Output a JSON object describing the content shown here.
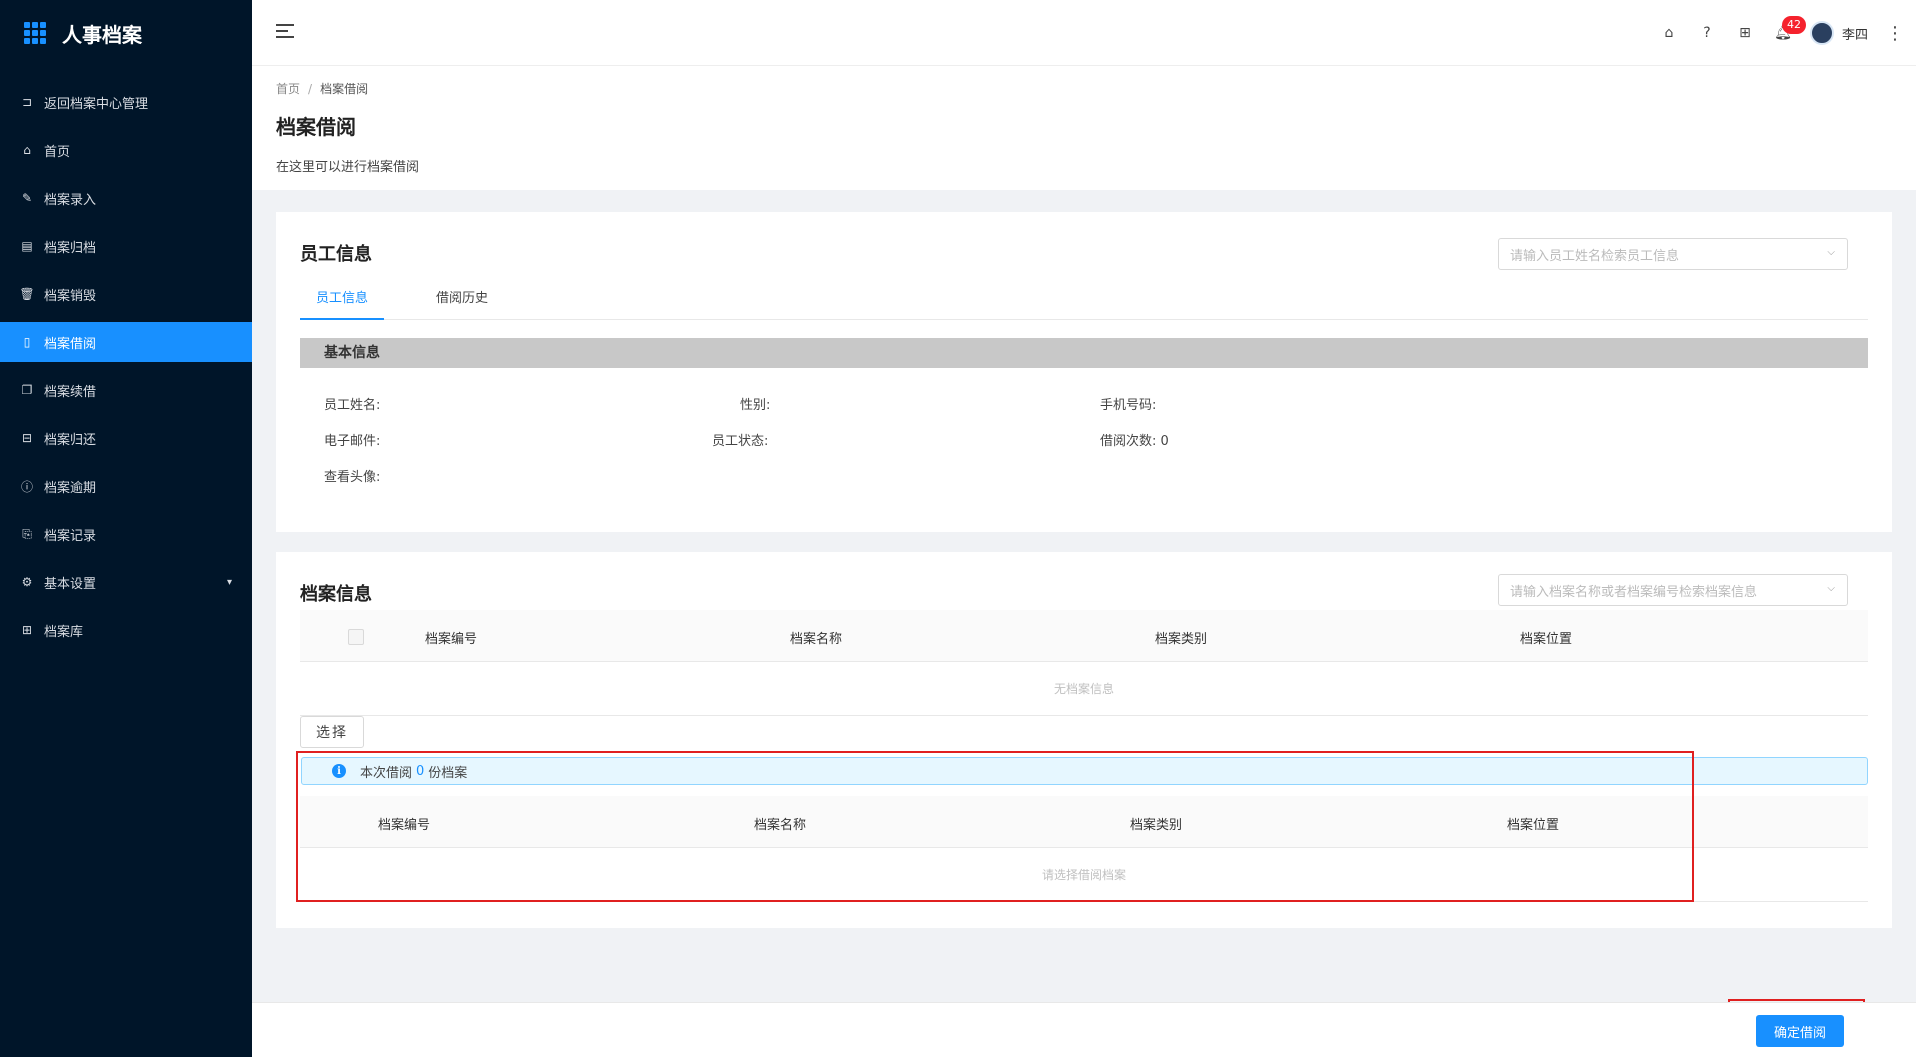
{
  "app": {
    "title": "人事档案"
  },
  "sidebar": {
    "items": [
      {
        "label": "返回档案中心管理",
        "icon": "exit-icon"
      },
      {
        "label": "首页",
        "icon": "home-icon"
      },
      {
        "label": "档案录入",
        "icon": "edit-icon"
      },
      {
        "label": "档案归档",
        "icon": "archive-icon"
      },
      {
        "label": "档案销毁",
        "icon": "trash-icon"
      },
      {
        "label": "档案借阅",
        "icon": "file-icon",
        "active": true
      },
      {
        "label": "档案续借",
        "icon": "copy-icon"
      },
      {
        "label": "档案归还",
        "icon": "return-icon"
      },
      {
        "label": "档案逾期",
        "icon": "warning-icon"
      },
      {
        "label": "档案记录",
        "icon": "record-icon"
      },
      {
        "label": "基本设置",
        "icon": "gear-icon",
        "has_children": true
      },
      {
        "label": "档案库",
        "icon": "grid-icon"
      }
    ]
  },
  "header": {
    "notification_count": "42",
    "user_name": "李四"
  },
  "page": {
    "breadcrumb": [
      "首页",
      "档案借阅"
    ],
    "title": "档案借阅",
    "description": "在这里可以进行档案借阅"
  },
  "employee": {
    "title": "员工信息",
    "search_placeholder": "请输入员工姓名检索员工信息",
    "tabs": [
      "员工信息",
      "借阅历史"
    ],
    "section_title": "基本信息",
    "fields": {
      "name": "员工姓名:",
      "gender": "性别:",
      "phone": "手机号码:",
      "email": "电子邮件:",
      "status": "员工状态:",
      "borrow_count": "借阅次数: 0",
      "avatar": "查看头像:"
    }
  },
  "archive": {
    "title": "档案信息",
    "search_placeholder": "请输入档案名称或者档案编号检索档案信息",
    "columns": [
      "档案编号",
      "档案名称",
      "档案类别",
      "档案位置"
    ],
    "empty_text": "无档案信息",
    "select_button": "选择",
    "alert_prefix": "本次借阅",
    "alert_count": "0",
    "alert_suffix": "份档案",
    "selected_columns": [
      "档案编号",
      "档案名称",
      "档案类别",
      "档案位置"
    ],
    "selected_empty_text": "请选择借阅档案"
  },
  "footer": {
    "confirm_button": "确定借阅"
  },
  "colors": {
    "primary": "#1890ff",
    "sidebar_bg": "#001529",
    "highlight": "#e02020",
    "badge": "#f5222d"
  }
}
